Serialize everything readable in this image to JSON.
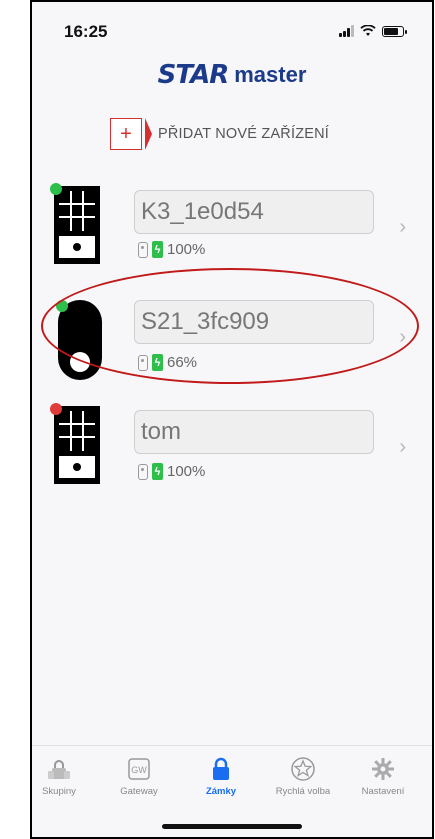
{
  "status_bar": {
    "time": "16:25"
  },
  "brand": {
    "star": "STAR",
    "master": "master"
  },
  "add_device": {
    "icon": "+",
    "label": "PŘIDAT NOVÉ ZAŘÍZENÍ"
  },
  "devices": [
    {
      "name": "K3_1e0d54",
      "battery": "100%",
      "status": "online",
      "type": "keypad"
    },
    {
      "name": "S21_3fc909",
      "battery": "66%",
      "status": "online",
      "type": "pill"
    },
    {
      "name": "tom",
      "battery": "100%",
      "status": "offline",
      "type": "keypad"
    }
  ],
  "tabs": [
    {
      "label": "Skupiny",
      "icon": "lock-group-icon"
    },
    {
      "label": "Gateway",
      "icon": "gateway-icon"
    },
    {
      "label": "Zámky",
      "icon": "lock-icon",
      "active": true
    },
    {
      "label": "Rychlá volba",
      "icon": "star-icon"
    },
    {
      "label": "Nastavení",
      "icon": "gear-icon"
    }
  ],
  "colors": {
    "accent": "#1a6df0",
    "brand": "#1b3a8a",
    "online": "#2dbf4a",
    "offline": "#e03a3a",
    "annotation": "#c11a1a"
  }
}
